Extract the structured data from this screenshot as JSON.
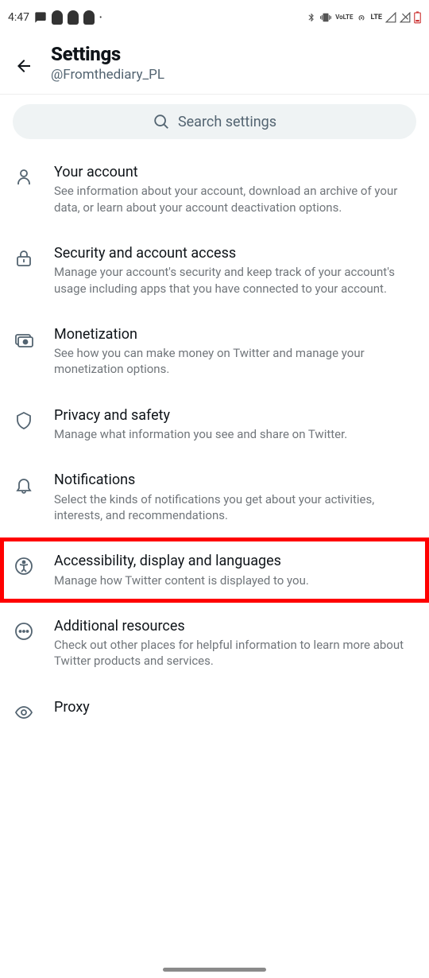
{
  "status_bar": {
    "time": "4:47",
    "lte": "LTE",
    "volte": "VoLTE"
  },
  "header": {
    "title": "Settings",
    "subtitle": "@Fromthediary_PL"
  },
  "search": {
    "placeholder": "Search settings"
  },
  "items": [
    {
      "title": "Your account",
      "desc": "See information about your account, download an archive of your data, or learn about your account deactivation options."
    },
    {
      "title": "Security and account access",
      "desc": "Manage your account's security and keep track of your account's usage including apps that you have connected to your account."
    },
    {
      "title": "Monetization",
      "desc": "See how you can make money on Twitter and manage your monetization options."
    },
    {
      "title": "Privacy and safety",
      "desc": "Manage what information you see and share on Twitter."
    },
    {
      "title": "Notifications",
      "desc": "Select the kinds of notifications you get about your activities, interests, and recommendations."
    },
    {
      "title": "Accessibility, display and languages",
      "desc": "Manage how Twitter content is displayed to you."
    },
    {
      "title": "Additional resources",
      "desc": "Check out other places for helpful information to learn more about Twitter products and services."
    },
    {
      "title": "Proxy",
      "desc": ""
    }
  ]
}
